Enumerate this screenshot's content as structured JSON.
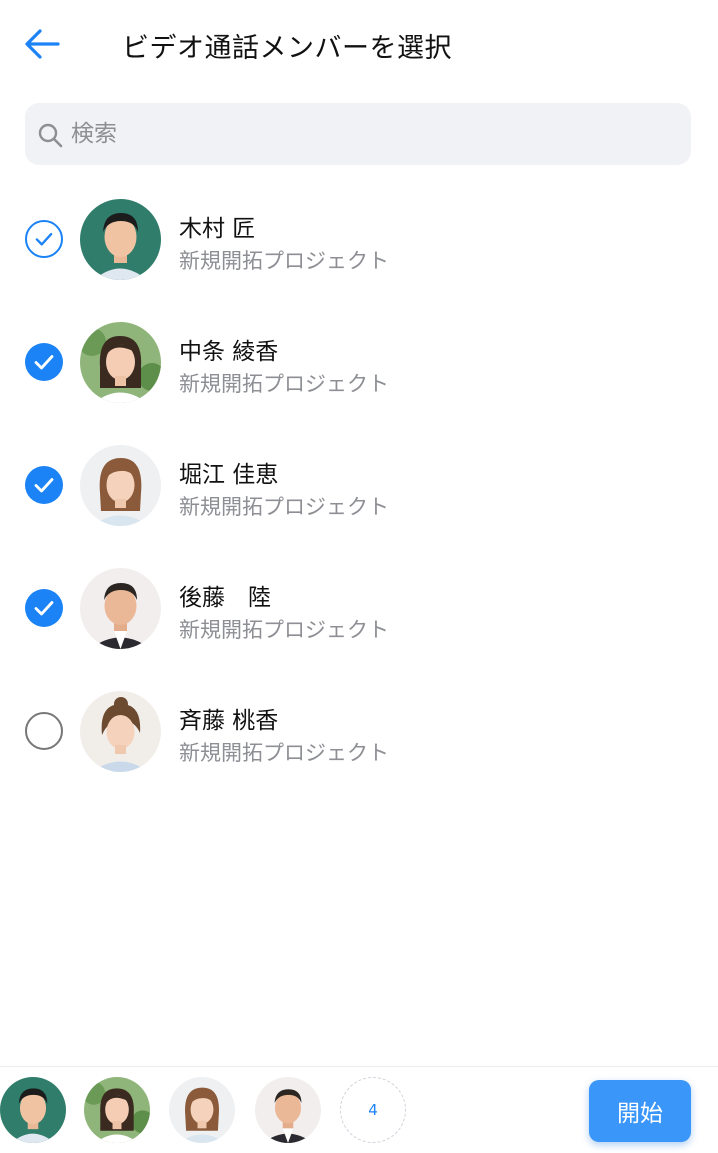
{
  "header": {
    "title": "ビデオ通話メンバーを選択",
    "back_icon": "arrow-left-icon"
  },
  "search": {
    "placeholder": "検索",
    "value": ""
  },
  "colors": {
    "accent": "#1b83f5",
    "button": "#3a96f8",
    "muted_text": "#8d8f94",
    "search_bg": "#f1f2f6"
  },
  "members": [
    {
      "name": "木村 匠",
      "group": "新規開拓プロジェクト",
      "checked": true
    },
    {
      "name": "中条 綾香",
      "group": "新規開拓プロジェクト",
      "checked": true
    },
    {
      "name": "堀江 佳恵",
      "group": "新規開拓プロジェクト",
      "checked": true
    },
    {
      "name": "後藤　陸",
      "group": "新規開拓プロジェクト",
      "checked": true
    },
    {
      "name": "斉藤 桃香",
      "group": "新規開拓プロジェクト",
      "checked": false
    }
  ],
  "footer": {
    "selected_count": "4",
    "start_label": "開始"
  }
}
